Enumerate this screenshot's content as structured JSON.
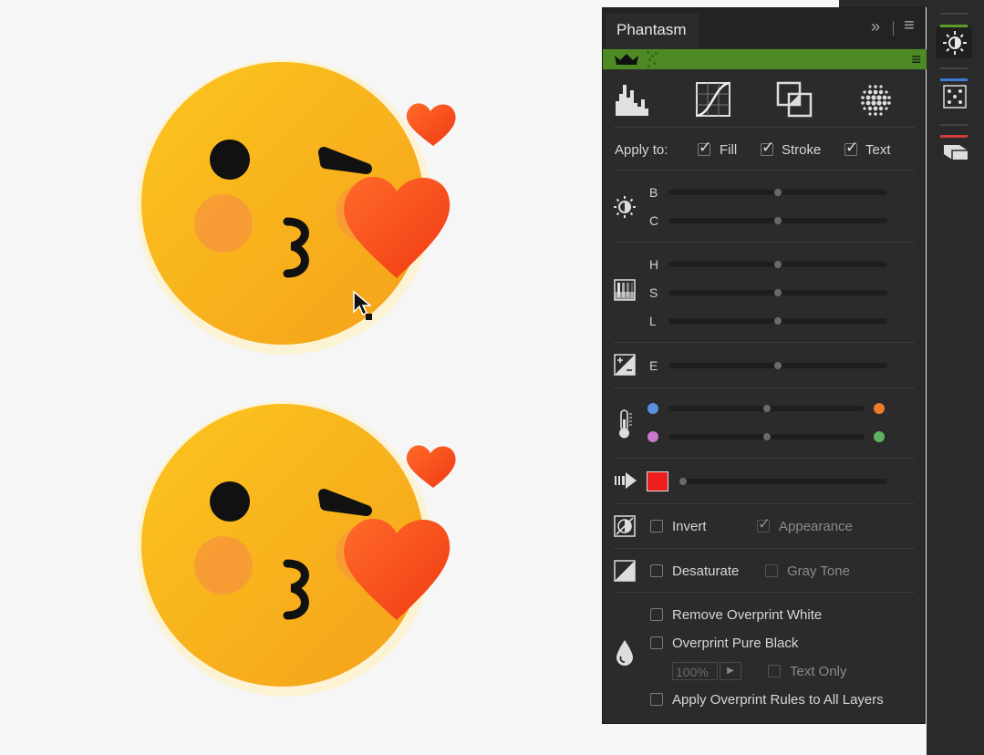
{
  "panel": {
    "tab_title": "Phantasm",
    "expand_glyph": "»",
    "menu_glyph": "≡",
    "apply_to": {
      "label": "Apply to:",
      "options": [
        {
          "label": "Fill",
          "checked": true
        },
        {
          "label": "Stroke",
          "checked": true
        },
        {
          "label": "Text",
          "checked": true
        }
      ]
    },
    "brightness_contrast": {
      "labels": [
        "B",
        "C"
      ]
    },
    "hsl": {
      "labels": [
        "H",
        "S",
        "L"
      ]
    },
    "exposure": {
      "label": "E"
    },
    "temperature": {
      "colors": {
        "left_top": "#5b8fe0",
        "right_top": "#f07a2c",
        "left_bottom": "#c779c9",
        "right_bottom": "#5fb35f"
      }
    },
    "replace_color": {
      "swatch": "#ee1d1d"
    },
    "invert": {
      "label": "Invert",
      "appearance_label": "Appearance"
    },
    "desaturate": {
      "label": "Desaturate",
      "gray_tone_label": "Gray Tone"
    },
    "overprint": {
      "remove_white": "Remove Overprint White",
      "pure_black": "Overprint Pure Black",
      "percent": "100%",
      "text_only": "Text Only",
      "apply_all": "Apply Overprint Rules to All Layers"
    }
  },
  "colors": {
    "accent_green": "#4e8a23",
    "panel_bg": "#2b2b2b",
    "emoji_yellow": "#f7b218",
    "heart_red": "#f4511e"
  }
}
